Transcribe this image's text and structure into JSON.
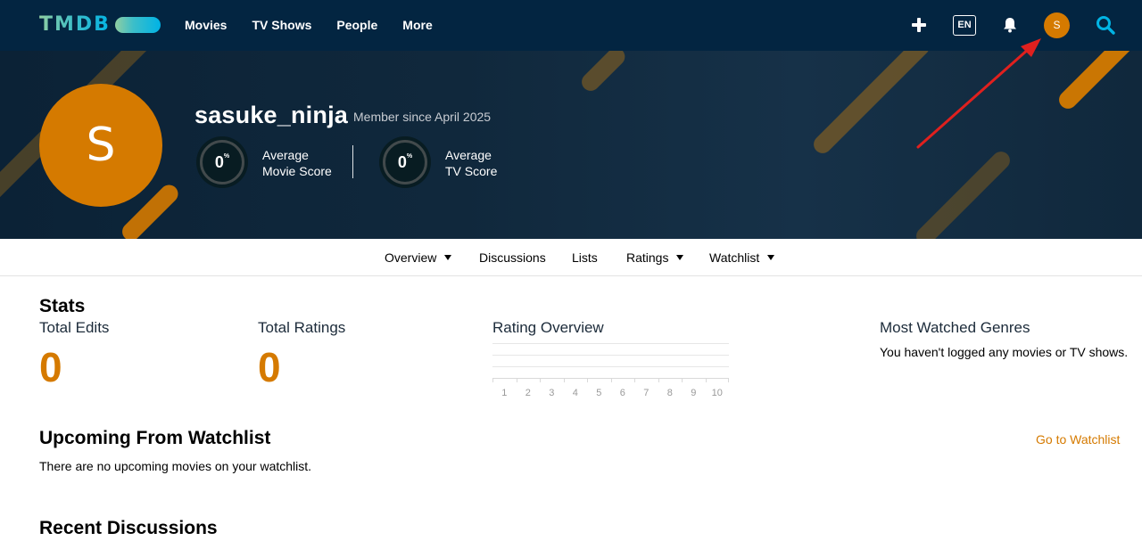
{
  "nav": {
    "logo_text": "TMDB",
    "links": [
      "Movies",
      "TV Shows",
      "People",
      "More"
    ],
    "lang": "EN",
    "avatar_initial": "S"
  },
  "profile": {
    "avatar_initial": "S",
    "username": "sasuke_ninja",
    "member_since": "Member since April 2025",
    "movie_score": {
      "value": "0",
      "unit": "%",
      "label_line1": "Average",
      "label_line2": "Movie Score"
    },
    "tv_score": {
      "value": "0",
      "unit": "%",
      "label_line1": "Average",
      "label_line2": "TV Score"
    }
  },
  "subnav": {
    "overview": "Overview",
    "discussions": "Discussions",
    "lists": "Lists",
    "ratings": "Ratings",
    "watchlist": "Watchlist"
  },
  "stats": {
    "title": "Stats",
    "total_edits_label": "Total Edits",
    "total_edits_value": "0",
    "total_ratings_label": "Total Ratings",
    "total_ratings_value": "0",
    "rating_overview_label": "Rating Overview",
    "rating_ticks": [
      "1",
      "2",
      "3",
      "4",
      "5",
      "6",
      "7",
      "8",
      "9",
      "10"
    ],
    "genres_label": "Most Watched Genres",
    "genres_empty": "You haven't logged any movies or TV shows."
  },
  "upcoming": {
    "title": "Upcoming From Watchlist",
    "empty": "There are no upcoming movies on your watchlist.",
    "link": "Go to Watchlist"
  },
  "discussions": {
    "title": "Recent Discussions"
  },
  "colors": {
    "nav_bg": "#032541",
    "accent": "#d57a00",
    "annotation": "#e0201e"
  }
}
